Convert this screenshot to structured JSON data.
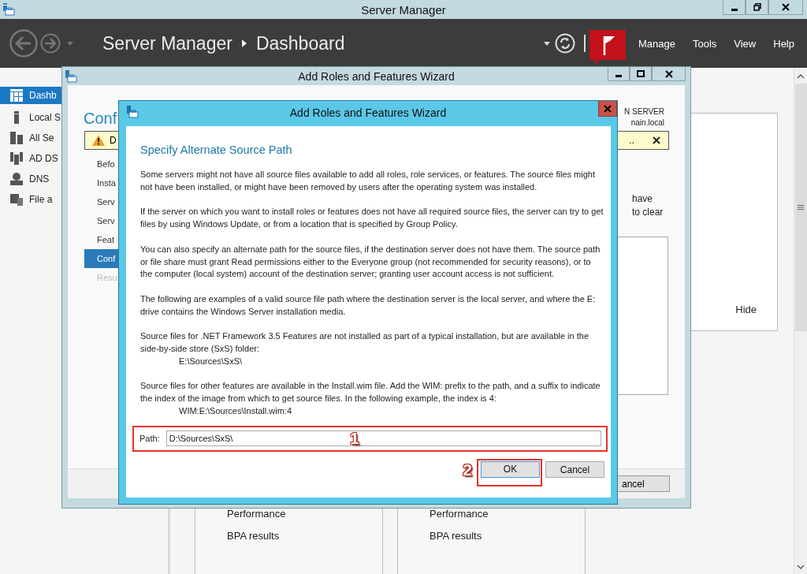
{
  "window": {
    "title": "Server Manager"
  },
  "header": {
    "breadcrumb": [
      "Server Manager",
      "Dashboard"
    ],
    "menu": [
      "Manage",
      "Tools",
      "View",
      "Help"
    ]
  },
  "sidebar": {
    "items": [
      {
        "label": "Dashb",
        "selected": true,
        "kind": "dashboard"
      },
      {
        "label": "Local S",
        "selected": false,
        "kind": "server"
      },
      {
        "label": "All Se",
        "selected": false,
        "kind": "servers"
      },
      {
        "label": "AD DS",
        "selected": false,
        "kind": "directory"
      },
      {
        "label": "DNS",
        "selected": false,
        "kind": "dns"
      },
      {
        "label": "File a",
        "selected": false,
        "kind": "files"
      }
    ]
  },
  "dashboard": {
    "hide_link": "Hide",
    "tiles": [
      {
        "items": [
          "Performance",
          "BPA results"
        ]
      },
      {
        "items": [
          "Performance",
          "BPA results"
        ]
      }
    ]
  },
  "wizard": {
    "title": "Add Roles and Features Wizard",
    "heading": "Conf",
    "server_name": [
      "N SERVER",
      "nain.local"
    ],
    "warning": {
      "text": "D",
      "tail": ".."
    },
    "steps": [
      {
        "label": "Befo",
        "selected": false,
        "disabled": false
      },
      {
        "label": "Insta",
        "selected": false,
        "disabled": false
      },
      {
        "label": "Serv",
        "selected": false,
        "disabled": false
      },
      {
        "label": "Serv",
        "selected": false,
        "disabled": false
      },
      {
        "label": "Feat",
        "selected": false,
        "disabled": false
      },
      {
        "label": "Conf",
        "selected": true,
        "disabled": false
      },
      {
        "label": "Resu",
        "selected": false,
        "disabled": true
      }
    ],
    "text_fragments": [
      "have",
      "to clear"
    ],
    "cancel_button": "ancel"
  },
  "dialog": {
    "title": "Add Roles and Features Wizard",
    "heading": "Specify Alternate Source Path",
    "paragraphs": [
      {
        "text": "Some servers might not have all source files available to add all roles, role services, or features. The source files might not have been installed, or might have been removed by users after the operating system was installed."
      },
      {
        "text": "If the server on which you want to install roles or features does not have all required source files, the server can try to get files by using Windows Update, or from a location that is specified by Group Policy."
      },
      {
        "text": "You can also specify an alternate path for the source files, if the destination server does not have them. The source path or file share must grant Read permissions either to the Everyone group (not recommended for security reasons), or to the computer (local system) account of the destination server; granting user account access is not sufficient."
      },
      {
        "text": "The following are examples of a valid source file path where the destination server is the local server, and where the E: drive contains the Windows Server installation media."
      },
      {
        "text": "Source files for .NET Framework 3.5 Features are not installed as part of a typical installation, but are available in the side-by-side store (SxS) folder:",
        "example": "E:\\Sources\\SxS\\"
      },
      {
        "text": "Source files for other features are available in the Install.wim file. Add the WIM: prefix to the path, and a suffix to indicate the index of the image from which to get source files. In the following example, the index is 4:",
        "example": "WIM:E:\\Sources\\Install.wim:4"
      }
    ],
    "path": {
      "label": "Path:",
      "value": "D:\\Sources\\SxS\\"
    },
    "buttons": [
      {
        "label": "OK",
        "default": true
      },
      {
        "label": "Cancel",
        "default": false
      }
    ]
  },
  "annotations": [
    "1",
    "2"
  ]
}
